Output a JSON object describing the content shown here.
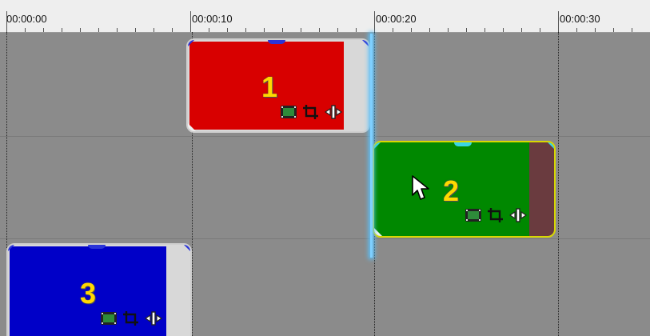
{
  "ruler": {
    "timestamps": [
      "00:00:00",
      "00:00:10",
      "00:00:20",
      "00:00:30"
    ]
  },
  "clips": [
    {
      "label": "1",
      "color": "#d80000",
      "track": 1
    },
    {
      "label": "2",
      "color": "#008800",
      "track": 2,
      "selected": true,
      "selected_border_color": "#d8d800",
      "tail_color": "#6a3b3f"
    },
    {
      "label": "3",
      "color": "#0000c8",
      "track": 3
    }
  ],
  "icons": [
    "film-icon",
    "crop-icon",
    "split-icon"
  ]
}
